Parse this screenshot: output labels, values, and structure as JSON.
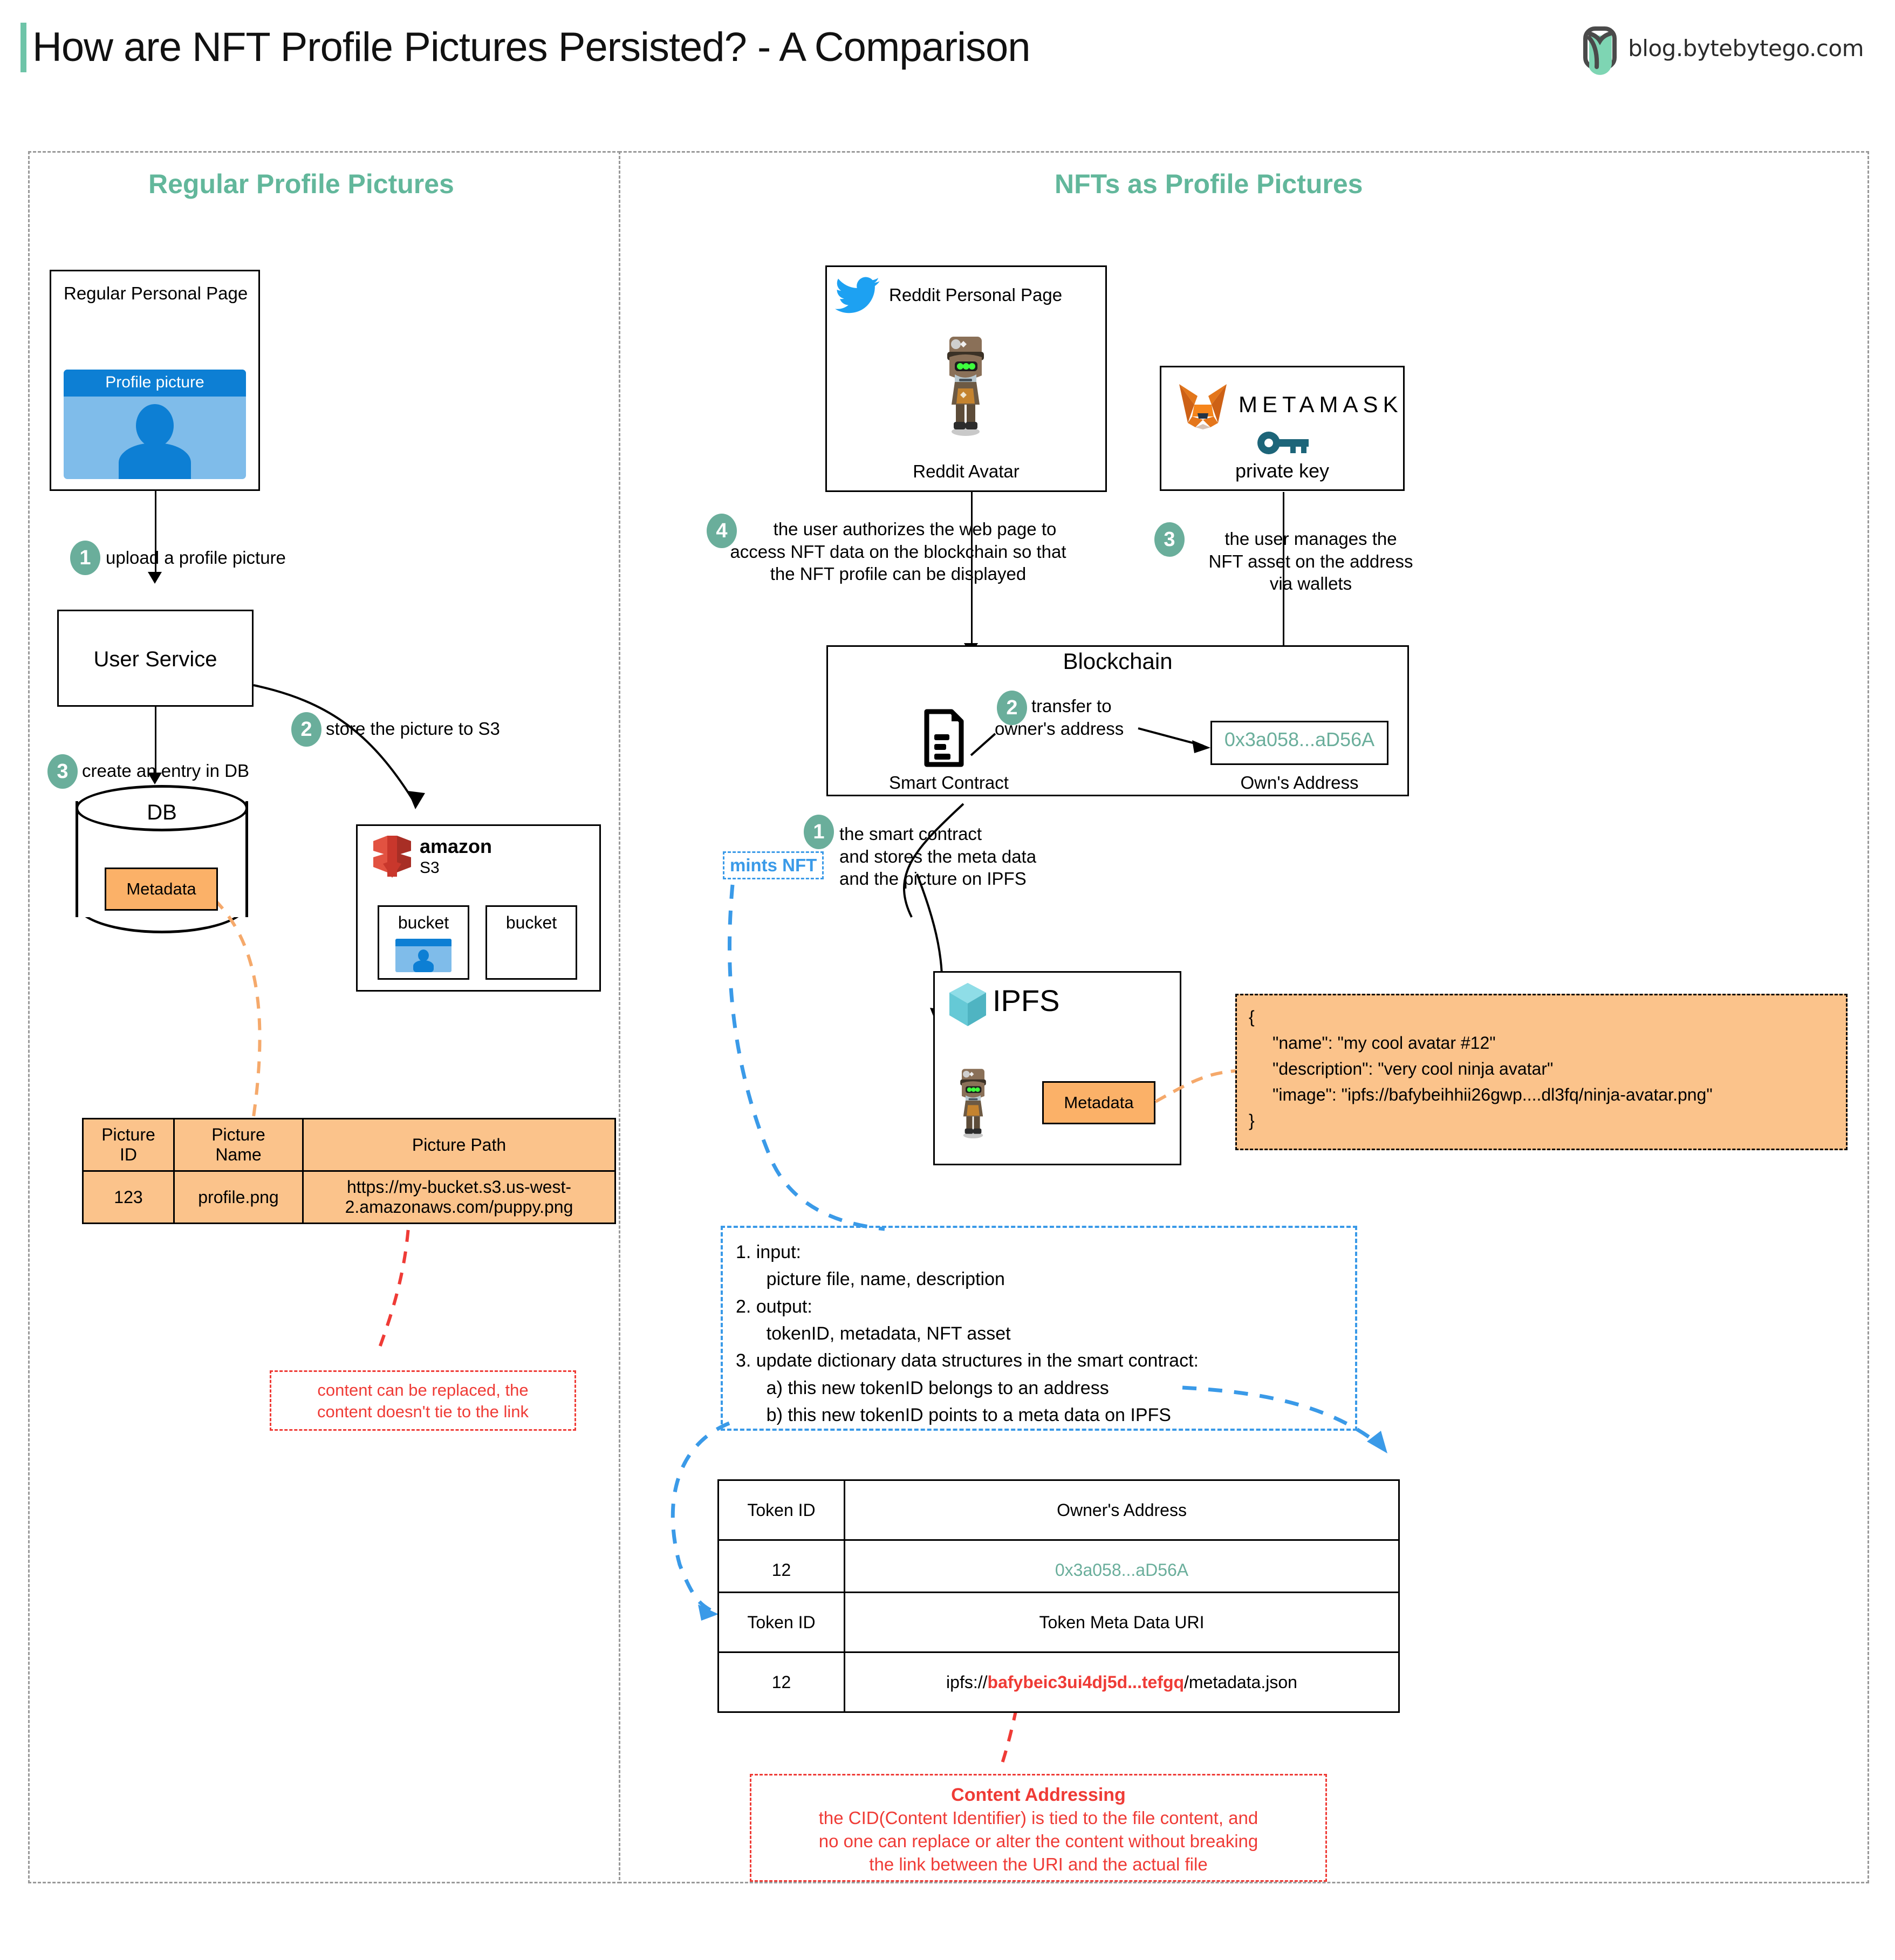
{
  "header": {
    "title": "How are NFT Profile Pictures Persisted? - A Comparison",
    "brand": "blog.bytebytego.com",
    "accent_color": "#6ec4a8"
  },
  "panels": {
    "left_title": "Regular Profile Pictures",
    "right_title": "NFTs as Profile Pictures"
  },
  "left": {
    "personal_page": {
      "title": "Regular Personal Page",
      "profile_widget_label": "Profile picture"
    },
    "steps": [
      {
        "num": "1",
        "text": "upload a profile picture"
      },
      {
        "num": "2",
        "text": "store the picture to S3"
      },
      {
        "num": "3",
        "text": "create an entry in DB"
      }
    ],
    "user_service": "User Service",
    "db": {
      "title": "DB",
      "metadata_label": "Metadata"
    },
    "s3": {
      "brand": "amazon",
      "product": "S3",
      "bucket1": "bucket",
      "bucket2": "bucket"
    },
    "table": {
      "headers": [
        "Picture ID",
        "Picture Name",
        "Picture Path"
      ],
      "header_lines": [
        [
          "Picture",
          "ID"
        ],
        [
          "Picture",
          "Name"
        ],
        [
          "Picture Path"
        ]
      ],
      "rows": [
        {
          "id": "123",
          "name": "profile.png",
          "path_line1": "https://my-bucket.s3.us-west-",
          "path_line2": "2.amazonaws.com/puppy.png"
        }
      ]
    },
    "warning": {
      "line1": "content can be replaced, the",
      "line2": "content doesn't tie to the link",
      "color": "#ef3b36"
    }
  },
  "right": {
    "reddit_page": {
      "title": "Reddit Personal Page",
      "avatar_caption": "Reddit Avatar"
    },
    "metamask": {
      "brand": "METAMASK",
      "caption": "private key"
    },
    "step4": {
      "num": "4",
      "line1": "the user authorizes the web page to",
      "line2": "access NFT data on the blockchain so that",
      "line3": "the NFT profile can be displayed"
    },
    "step3": {
      "num": "3",
      "line1": "the user manages the",
      "line2": "NFT asset on the address",
      "line3": "via wallets"
    },
    "blockchain": {
      "title": "Blockchain",
      "smart_contract_caption": "Smart Contract",
      "step2": {
        "num": "2",
        "line1": "transfer to",
        "line2": "owner's address"
      },
      "address_value": "0x3a058...aD56A",
      "address_caption": "Own's Address",
      "address_color": "#6aae9b"
    },
    "step1": {
      "num": "1",
      "mints_label": "mints NFT",
      "line1": "the smart contract",
      "line2": "and stores the meta data",
      "line3": "and the picture on IPFS"
    },
    "ipfs": {
      "title": "IPFS",
      "metadata_label": "Metadata"
    },
    "json_metadata": {
      "open": "{",
      "name": "\"name\": \"my cool avatar #12\"",
      "description": "\"description\": \"very cool ninja avatar\"",
      "image": "\"image\": \"ipfs://bafybeihhii26gwp....dl3fq/ninja-avatar.png\"",
      "close": "}"
    },
    "contract_spec": [
      "1. input:",
      "      picture file, name, description",
      "2. output:",
      "      tokenID, metadata, NFT asset",
      "3. update dictionary data structures in the smart contract:",
      "      a) this new tokenID belongs to an address",
      "      b) this new tokenID points to a meta data on IPFS"
    ],
    "owner_table": {
      "headers": [
        "Token ID",
        "Owner's Address"
      ],
      "rows": [
        {
          "token_id": "12",
          "owner_address": "0x3a058...aD56A"
        }
      ]
    },
    "uri_table": {
      "headers": [
        "Token ID",
        "Token Meta Data URI"
      ],
      "rows": [
        {
          "token_id": "12",
          "uri_prefix": "ipfs://",
          "uri_cid": "bafybeic3ui4dj5d...tefgq",
          "uri_suffix": "/metadata.json"
        }
      ]
    },
    "content_addressing": {
      "title": "Content Addressing",
      "line1": "the CID(Content Identifier) is tied to the file content, and",
      "line2": "no one can replace or alter the content without breaking",
      "line3": "the link between the URI and the actual file",
      "color": "#ef3b36"
    }
  }
}
